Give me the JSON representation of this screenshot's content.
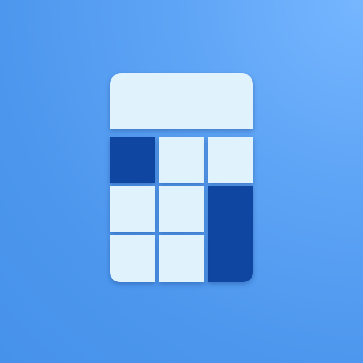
{
  "icon": {
    "name": "calculator-icon",
    "colors": {
      "light": "#e0f3fd",
      "dark": "#0e46a2",
      "background_light": "#76b6ff",
      "background_dark": "#4691ea"
    }
  }
}
